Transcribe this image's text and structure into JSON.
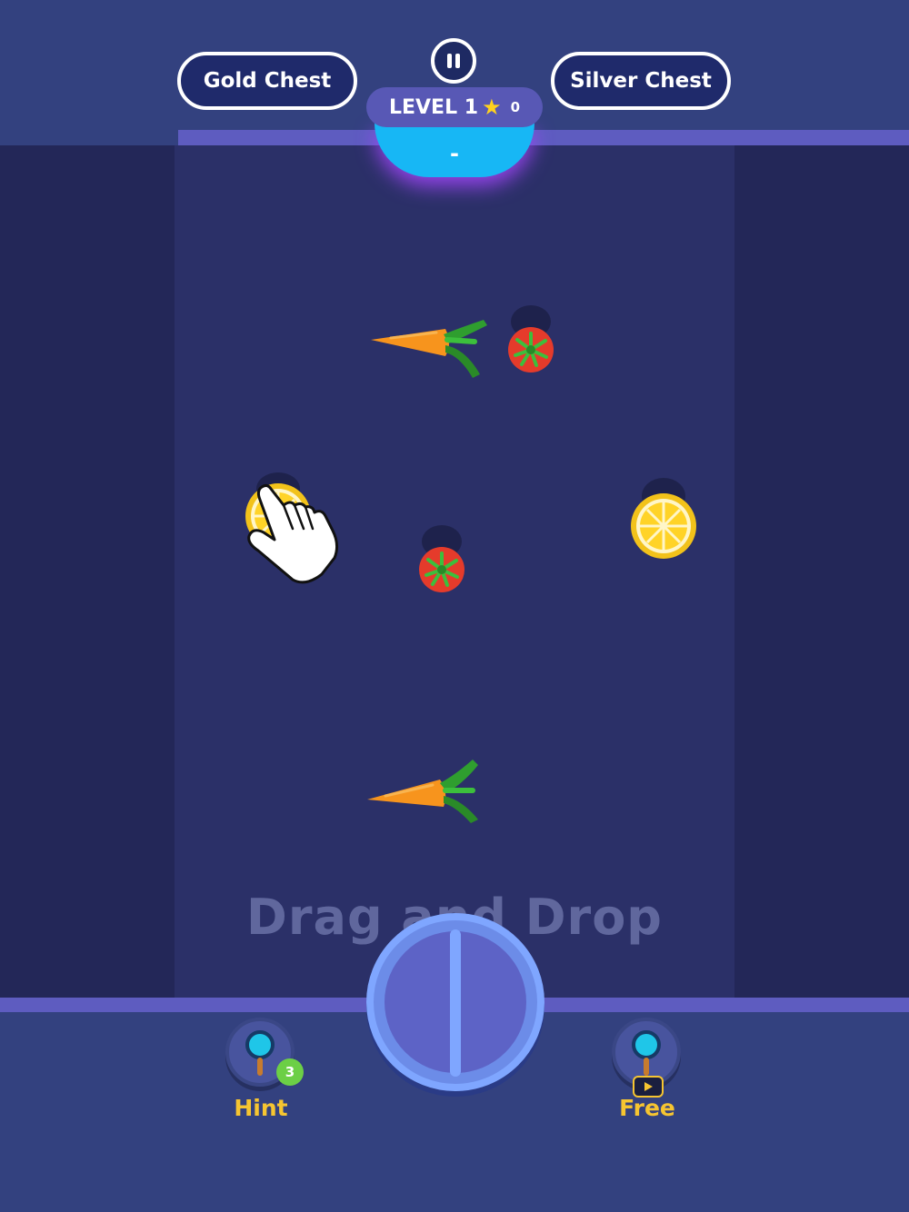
{
  "header": {
    "gold_chest_label": "Gold Chest",
    "silver_chest_label": "Silver Chest",
    "level_label": "LEVEL 1",
    "star_count": "0",
    "timer_text": "-"
  },
  "board": {
    "instruction": "Drag and Drop",
    "items": [
      "carrot",
      "tomato",
      "lemon",
      "tomato",
      "lemon",
      "carrot"
    ]
  },
  "footer": {
    "hint_label": "Hint",
    "hint_count": "3",
    "free_label": "Free"
  },
  "colors": {
    "background": "#232758",
    "play_area": "#2b3068",
    "header": "#33417f",
    "accent_blue": "#17b7f5",
    "label_gold": "#f6c531",
    "badge_green": "#6ccf46"
  },
  "icons": [
    "pause-icon",
    "star-icon",
    "magnifier-icon",
    "video-icon",
    "hand-pointer-icon"
  ]
}
